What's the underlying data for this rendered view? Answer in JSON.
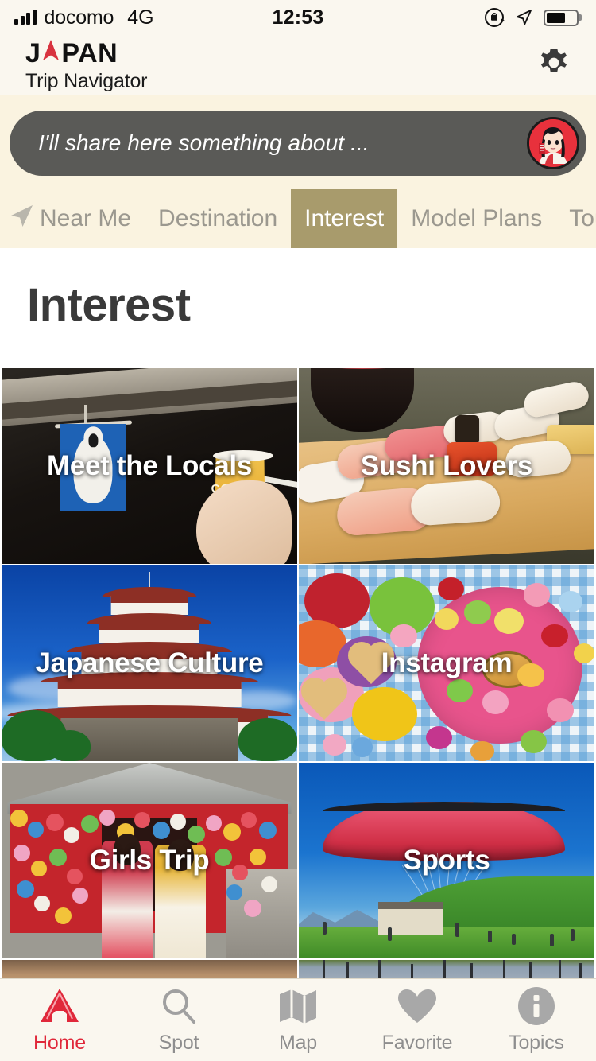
{
  "status_bar": {
    "carrier": "docomo",
    "network": "4G",
    "time": "12:53",
    "icons": {
      "signal": "signal-bars-icon",
      "rotation_lock": "rotation-lock-icon",
      "location": "location-arrow-icon",
      "battery": "battery-icon"
    },
    "battery_level": 65
  },
  "header": {
    "brand_prefix": "J",
    "brand_suffix": "PAN",
    "brand_arrow": "red-navigation-arrow",
    "subtitle": "Trip Navigator",
    "settings_icon": "gear-icon"
  },
  "share": {
    "placeholder": "I'll share here something about ...",
    "avatar": "shrine-maiden-avatar"
  },
  "nav_tabs": {
    "location_icon": "location-arrow-icon",
    "items": [
      {
        "label": "Near Me",
        "active": false
      },
      {
        "label": "Destination",
        "active": false
      },
      {
        "label": "Interest",
        "active": true
      },
      {
        "label": "Model Plans",
        "active": false
      },
      {
        "label": "Tour &",
        "active": false
      }
    ],
    "active_bg": "#a89b6c",
    "active_fg": "#ffffff",
    "inactive_fg": "#9b988f"
  },
  "page": {
    "title": "Interest"
  },
  "tiles": [
    {
      "label": "Meet the Locals",
      "art": "art-locals"
    },
    {
      "label": "Sushi Lovers",
      "art": "art-sushi"
    },
    {
      "label": "Japanese Culture",
      "art": "art-castle"
    },
    {
      "label": "Instagram",
      "art": "art-insta"
    },
    {
      "label": "Girls Trip",
      "art": "art-girls"
    },
    {
      "label": "Sports",
      "art": "art-sports"
    }
  ],
  "bottom_nav": {
    "items": [
      {
        "label": "Home",
        "icon": "home-icon",
        "active": true
      },
      {
        "label": "Spot",
        "icon": "search-icon",
        "active": false
      },
      {
        "label": "Map",
        "icon": "map-icon",
        "active": false
      },
      {
        "label": "Favorite",
        "icon": "heart-icon",
        "active": false
      },
      {
        "label": "Topics",
        "icon": "info-icon",
        "active": false
      }
    ],
    "active_color": "#e0283a",
    "inactive_color": "#8e8e8e"
  },
  "colors": {
    "page_bg": "#faf7ef",
    "band_bg": "#faf3e0",
    "share_bar": "#5a5a57",
    "accent_red": "#e0283a",
    "tab_active": "#a89b6c"
  }
}
